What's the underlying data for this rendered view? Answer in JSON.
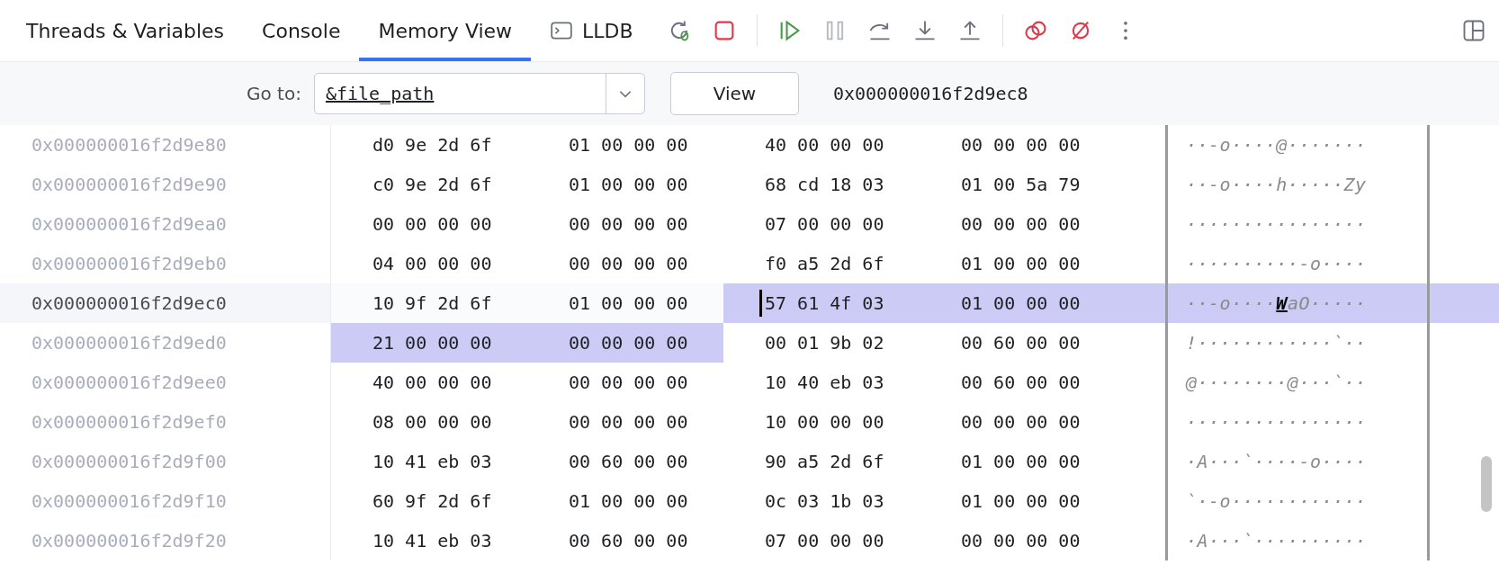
{
  "tabs": [
    {
      "label": "Threads & Variables",
      "selected": false,
      "kind": "text"
    },
    {
      "label": "Console",
      "selected": false,
      "kind": "text"
    },
    {
      "label": "Memory View",
      "selected": true,
      "kind": "text"
    },
    {
      "label": "LLDB",
      "selected": false,
      "kind": "terminal"
    }
  ],
  "goto": {
    "label": "Go to:",
    "value": "&file_path",
    "button": "View",
    "address": "0x000000016f2d9ec8"
  },
  "rows": [
    {
      "address": "0x000000016f2d9e80",
      "current": false,
      "groups": [
        {
          "bytes": "d0 9e 2d 6f",
          "selected": false,
          "cursor": false
        },
        {
          "bytes": "01 00 00 00",
          "selected": false,
          "cursor": false
        },
        {
          "bytes": "40 00 00 00",
          "selected": false,
          "cursor": false
        },
        {
          "bytes": "00 00 00 00",
          "selected": false,
          "cursor": false
        }
      ],
      "ascii": "··-o····@·······",
      "ascii_selected": false
    },
    {
      "address": "0x000000016f2d9e90",
      "current": false,
      "groups": [
        {
          "bytes": "c0 9e 2d 6f",
          "selected": false,
          "cursor": false
        },
        {
          "bytes": "01 00 00 00",
          "selected": false,
          "cursor": false
        },
        {
          "bytes": "68 cd 18 03",
          "selected": false,
          "cursor": false
        },
        {
          "bytes": "01 00 5a 79",
          "selected": false,
          "cursor": false
        }
      ],
      "ascii": "··-o····h·····Zy",
      "ascii_selected": false
    },
    {
      "address": "0x000000016f2d9ea0",
      "current": false,
      "groups": [
        {
          "bytes": "00 00 00 00",
          "selected": false,
          "cursor": false
        },
        {
          "bytes": "00 00 00 00",
          "selected": false,
          "cursor": false
        },
        {
          "bytes": "07 00 00 00",
          "selected": false,
          "cursor": false
        },
        {
          "bytes": "00 00 00 00",
          "selected": false,
          "cursor": false
        }
      ],
      "ascii": "················",
      "ascii_selected": false
    },
    {
      "address": "0x000000016f2d9eb0",
      "current": false,
      "groups": [
        {
          "bytes": "04 00 00 00",
          "selected": false,
          "cursor": false
        },
        {
          "bytes": "00 00 00 00",
          "selected": false,
          "cursor": false
        },
        {
          "bytes": "f0 a5 2d 6f",
          "selected": false,
          "cursor": false
        },
        {
          "bytes": "01 00 00 00",
          "selected": false,
          "cursor": false
        }
      ],
      "ascii": "··········-o····",
      "ascii_selected": false
    },
    {
      "address": "0x000000016f2d9ec0",
      "current": true,
      "groups": [
        {
          "bytes": "10 9f 2d 6f",
          "selected": false,
          "cursor": false
        },
        {
          "bytes": "01 00 00 00",
          "selected": false,
          "cursor": false
        },
        {
          "bytes": "57 61 4f 03",
          "selected": true,
          "cursor": true
        },
        {
          "bytes": "01 00 00 00",
          "selected": true,
          "cursor": false
        }
      ],
      "ascii": "··-o····**W**aO·····",
      "ascii_selected": true
    },
    {
      "address": "0x000000016f2d9ed0",
      "current": false,
      "groups": [
        {
          "bytes": "21 00 00 00",
          "selected": true,
          "cursor": false
        },
        {
          "bytes": "00 00 00 00",
          "selected": true,
          "cursor": false
        },
        {
          "bytes": "00 01 9b 02",
          "selected": false,
          "cursor": false
        },
        {
          "bytes": "00 60 00 00",
          "selected": false,
          "cursor": false
        }
      ],
      "ascii": "!············`··",
      "ascii_selected": false
    },
    {
      "address": "0x000000016f2d9ee0",
      "current": false,
      "groups": [
        {
          "bytes": "40 00 00 00",
          "selected": false,
          "cursor": false
        },
        {
          "bytes": "00 00 00 00",
          "selected": false,
          "cursor": false
        },
        {
          "bytes": "10 40 eb 03",
          "selected": false,
          "cursor": false
        },
        {
          "bytes": "00 60 00 00",
          "selected": false,
          "cursor": false
        }
      ],
      "ascii": "@········@···`··",
      "ascii_selected": false
    },
    {
      "address": "0x000000016f2d9ef0",
      "current": false,
      "groups": [
        {
          "bytes": "08 00 00 00",
          "selected": false,
          "cursor": false
        },
        {
          "bytes": "00 00 00 00",
          "selected": false,
          "cursor": false
        },
        {
          "bytes": "10 00 00 00",
          "selected": false,
          "cursor": false
        },
        {
          "bytes": "00 00 00 00",
          "selected": false,
          "cursor": false
        }
      ],
      "ascii": "················",
      "ascii_selected": false
    },
    {
      "address": "0x000000016f2d9f00",
      "current": false,
      "groups": [
        {
          "bytes": "10 41 eb 03",
          "selected": false,
          "cursor": false
        },
        {
          "bytes": "00 60 00 00",
          "selected": false,
          "cursor": false
        },
        {
          "bytes": "90 a5 2d 6f",
          "selected": false,
          "cursor": false
        },
        {
          "bytes": "01 00 00 00",
          "selected": false,
          "cursor": false
        }
      ],
      "ascii": "·A···`····-o····",
      "ascii_selected": false
    },
    {
      "address": "0x000000016f2d9f10",
      "current": false,
      "groups": [
        {
          "bytes": "60 9f 2d 6f",
          "selected": false,
          "cursor": false
        },
        {
          "bytes": "01 00 00 00",
          "selected": false,
          "cursor": false
        },
        {
          "bytes": "0c 03 1b 03",
          "selected": false,
          "cursor": false
        },
        {
          "bytes": "01 00 00 00",
          "selected": false,
          "cursor": false
        }
      ],
      "ascii": "`·-o············",
      "ascii_selected": false
    },
    {
      "address": "0x000000016f2d9f20",
      "current": false,
      "groups": [
        {
          "bytes": "10 41 eb 03",
          "selected": false,
          "cursor": false
        },
        {
          "bytes": "00 60 00 00",
          "selected": false,
          "cursor": false
        },
        {
          "bytes": "07 00 00 00",
          "selected": false,
          "cursor": false
        },
        {
          "bytes": "00 00 00 00",
          "selected": false,
          "cursor": false
        }
      ],
      "ascii": "·A···`··········",
      "ascii_selected": false
    }
  ]
}
